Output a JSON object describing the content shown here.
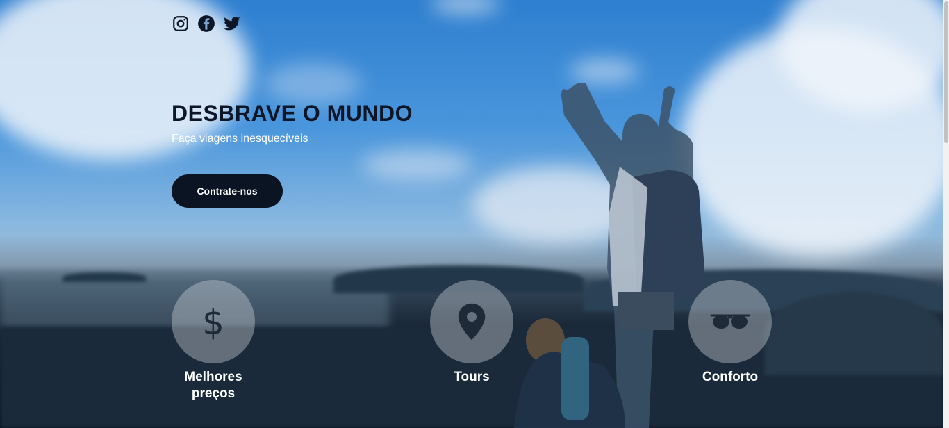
{
  "social": {
    "items": [
      {
        "icon": "instagram-icon"
      },
      {
        "icon": "facebook-icon"
      },
      {
        "icon": "twitter-icon"
      }
    ]
  },
  "hero": {
    "title": "DESBRAVE O MUNDO",
    "subtitle": "Faça viagens inesquecíveis",
    "cta_label": "Contrate-nos"
  },
  "features": [
    {
      "icon": "dollar-icon",
      "label": "Melhores preços"
    },
    {
      "icon": "map-pin-icon",
      "label": "Tours"
    },
    {
      "icon": "sunglasses-icon",
      "label": "Conforto"
    }
  ],
  "colors": {
    "title": "#0c1626",
    "button_bg": "#0b1422",
    "icon": "#1f2a38"
  }
}
